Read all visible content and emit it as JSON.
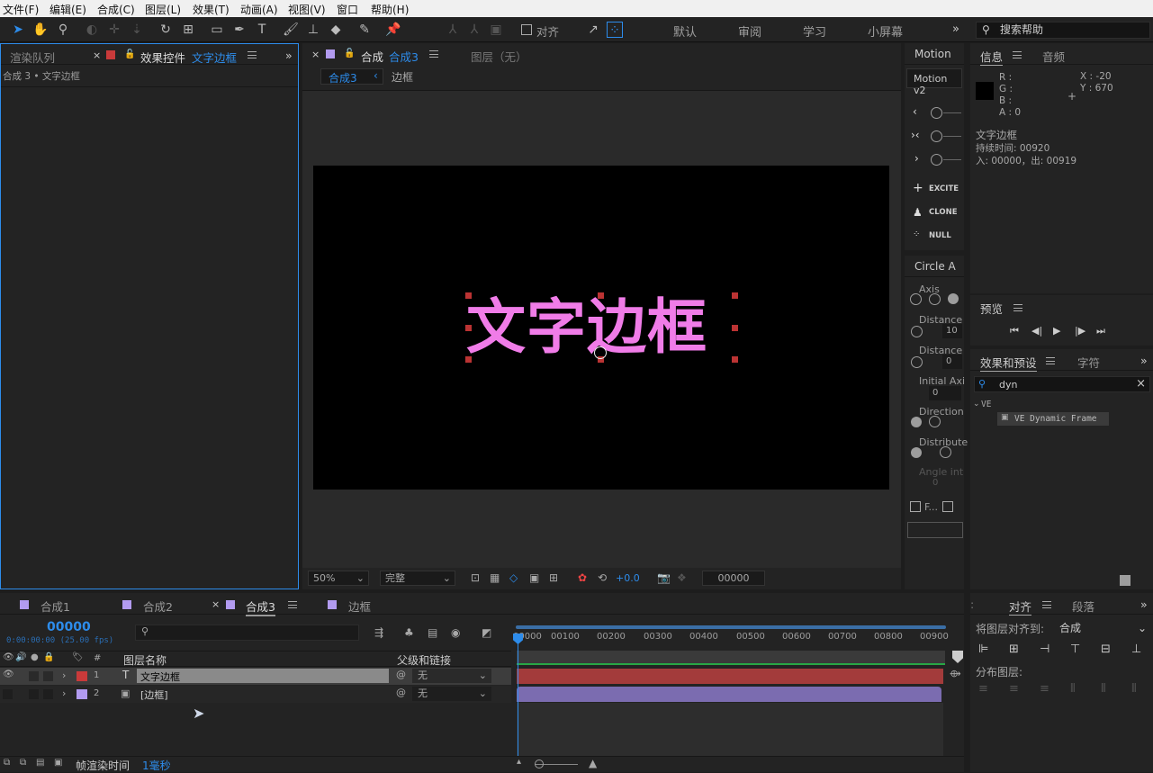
{
  "menu": [
    "文件(F)",
    "编辑(E)",
    "合成(C)",
    "图层(L)",
    "效果(T)",
    "动画(A)",
    "视图(V)",
    "窗口",
    "帮助(H)"
  ],
  "toolbar": {
    "align_label": "对齐",
    "workspaces": [
      "默认",
      "审阅",
      "学习",
      "小屏幕"
    ],
    "search_help": "搜索帮助"
  },
  "left_panel": {
    "tab_render": "渲染队列",
    "tab_effects": "效果控件",
    "effects_target": "文字边框",
    "breadcrumb": "合成 3 • 文字边框"
  },
  "comp_panel": {
    "tab_label": "合成",
    "tab_name": "合成3",
    "layer_tab": "图层（无）",
    "crumb_active": "合成3",
    "crumb_next": "边框",
    "canvas_text": "文字边框",
    "zoom": "50%",
    "quality": "完整",
    "exposure": "+0.0",
    "timecode": "00000"
  },
  "motion": {
    "tab": "Motion",
    "title": "Motion v2",
    "btn_excite": "EXCITE",
    "btn_clone": "CLONE",
    "btn_null": "NULL"
  },
  "circle": {
    "tab": "Circle A",
    "axis": "Axis",
    "distance1": "Distance",
    "distance1_val": "10",
    "distance2": "Distance",
    "distance2_val": "0",
    "initial": "Initial Axi",
    "initial_val": "0",
    "direction": "Direction",
    "distribute": "Distribute",
    "angle": "Angle int",
    "angle_val": "0",
    "fit": "F..."
  },
  "info": {
    "tab": "信息",
    "tab_audio": "音频",
    "r": "R :",
    "g": "G :",
    "b": "B :",
    "a": "A : 0",
    "x": "X : -20",
    "y": "Y : 670",
    "layer_name": "文字边框",
    "duration": "持续时间: 00920",
    "inout": "入: 00000，出: 00919"
  },
  "preview": {
    "title": "预览"
  },
  "effects_presets": {
    "tab": "效果和预设",
    "tab_char": "字符",
    "search": "dyn",
    "folder": "VE",
    "item": "VE Dynamic Frame"
  },
  "align": {
    "tab": "对齐",
    "tab_para": "段落",
    "align_to_label": "将图层对齐到:",
    "align_to_value": "合成",
    "distribute_label": "分布图层:"
  },
  "timeline": {
    "tabs": [
      "合成1",
      "合成2",
      "合成3",
      "边框"
    ],
    "timecode": "00000",
    "timecode_sub": "0:00:00:00 (25.00 fps)",
    "col_num": "#",
    "col_name": "图层名称",
    "col_parent": "父级和链接",
    "ruler": [
      "00000",
      "00100",
      "00200",
      "00300",
      "00400",
      "00500",
      "00600",
      "00700",
      "00800",
      "00900"
    ],
    "layers": [
      {
        "num": "1",
        "name": "文字边框",
        "parent": "无",
        "color": "#c93a3a"
      },
      {
        "num": "2",
        "name": "[边框]",
        "parent": "无",
        "color": "#b29bf0"
      }
    ],
    "render_label": "帧渲染时间",
    "render_value": "1毫秒"
  }
}
